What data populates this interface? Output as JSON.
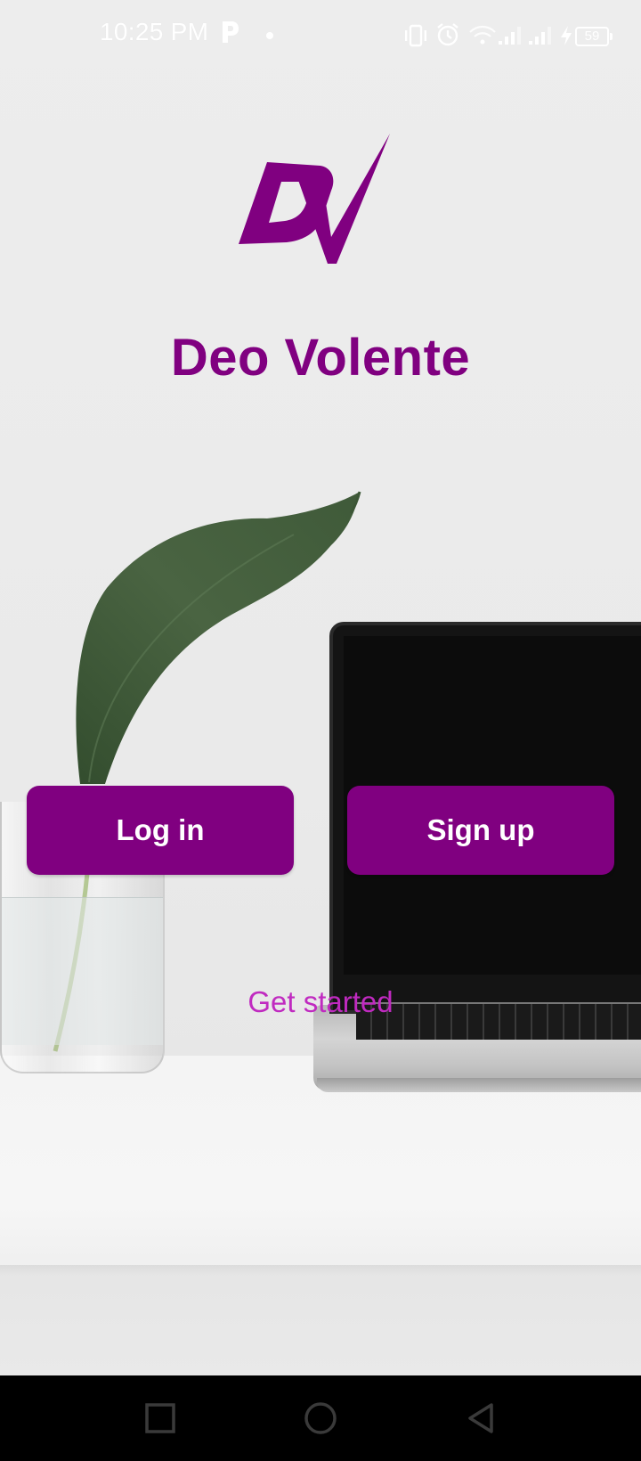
{
  "status_bar": {
    "time": "10:25 PM",
    "battery_level": "59",
    "icons": [
      "parking-p-icon",
      "notification-dot-icon",
      "vibrate-icon",
      "alarm-icon",
      "wifi-icon",
      "signal-1-icon",
      "signal-2-icon",
      "charging-icon",
      "battery-icon"
    ]
  },
  "app": {
    "title": "Deo Volente",
    "logo_name": "dv-logo",
    "brand_color": "#800080"
  },
  "actions": {
    "login_label": "Log in",
    "signup_label": "Sign up",
    "get_started_label": "Get started",
    "link_color": "#c02ac0"
  },
  "navigation_bar": {
    "buttons": [
      "recent-apps-square-icon",
      "home-circle-icon",
      "back-triangle-icon"
    ]
  }
}
